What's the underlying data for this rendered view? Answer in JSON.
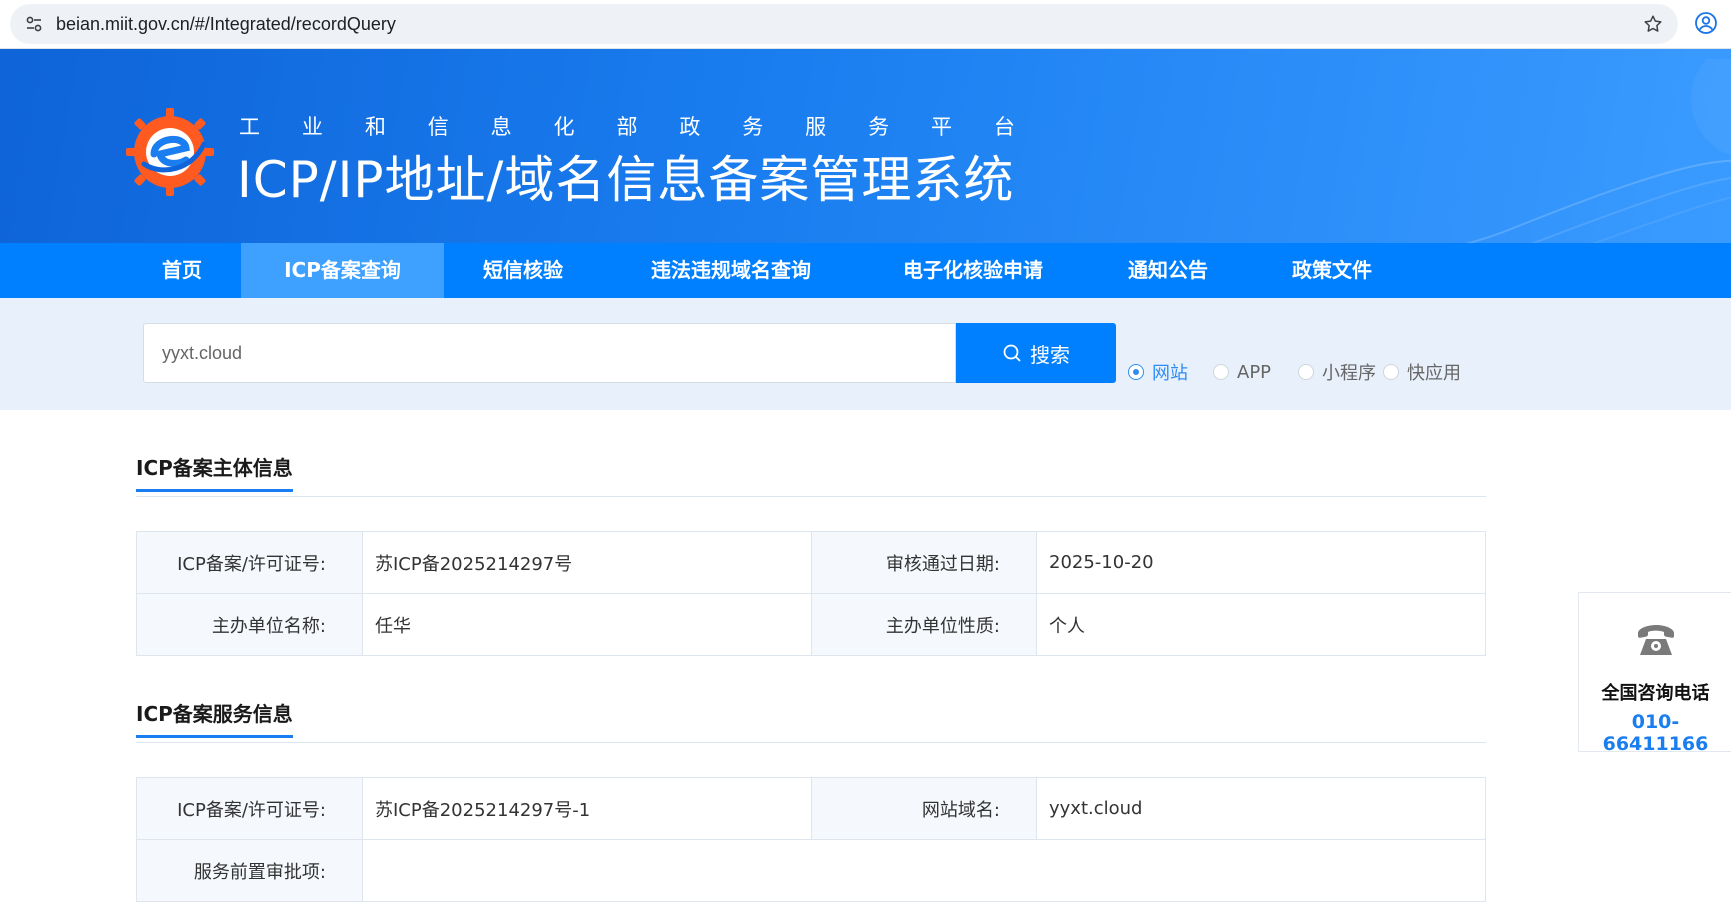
{
  "browser": {
    "url": "beian.miit.gov.cn/#/Integrated/recordQuery"
  },
  "header": {
    "platform_name": [
      "工",
      "业",
      "和",
      "信",
      "息",
      "化",
      "部",
      "政",
      "务",
      "服",
      "务",
      "平",
      "台"
    ],
    "system_title": "ICP/IP地址/域名信息备案管理系统"
  },
  "nav": {
    "items": [
      {
        "label": "首页",
        "active": false
      },
      {
        "label": "ICP备案查询",
        "active": true
      },
      {
        "label": "短信核验",
        "active": false
      },
      {
        "label": "违法违规域名查询",
        "active": false
      },
      {
        "label": "电子化核验申请",
        "active": false
      },
      {
        "label": "通知公告",
        "active": false
      },
      {
        "label": "政策文件",
        "active": false
      }
    ]
  },
  "search": {
    "value": "yyxt.cloud",
    "button_label": "搜索",
    "types": [
      {
        "label": "网站",
        "checked": true
      },
      {
        "label": "APP",
        "checked": false
      },
      {
        "label": "小程序",
        "checked": false
      },
      {
        "label": "快应用",
        "checked": false
      }
    ]
  },
  "entity_section": {
    "title": "ICP备案主体信息",
    "license_label": "ICP备案/许可证号:",
    "license_value": "苏ICP备2025214297号",
    "approve_date_label": "审核通过日期:",
    "approve_date_value": "2025-10-20",
    "org_name_label": "主办单位名称:",
    "org_name_value": "任华",
    "org_type_label": "主办单位性质:",
    "org_type_value": "个人"
  },
  "service_section": {
    "title": "ICP备案服务信息",
    "license_label": "ICP备案/许可证号:",
    "license_value": "苏ICP备2025214297号-1",
    "domain_label": "网站域名:",
    "domain_value": "yyxt.cloud",
    "pre_approval_label": "服务前置审批项:",
    "pre_approval_value": ""
  },
  "consult": {
    "title": "全国咨询电话",
    "phone": "010-66411166"
  },
  "colors": {
    "primary": "#0080ff",
    "nav_active": "#3ea1ff",
    "radio_checked": "#2f8cf5",
    "search_zone_bg": "#e8f1fb"
  }
}
